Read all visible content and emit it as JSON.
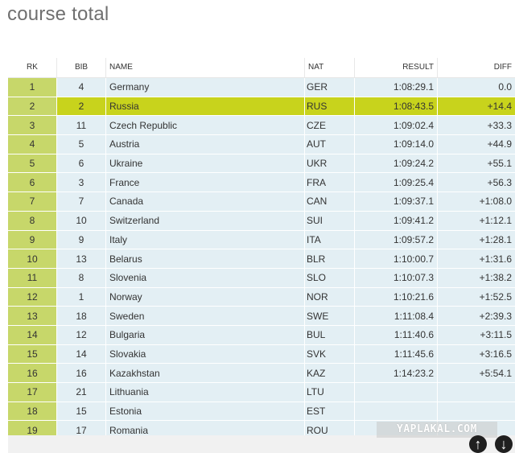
{
  "title": "course total",
  "columns": {
    "rk": "RK",
    "bib": "BIB",
    "name": "NAME",
    "nat": "NAT",
    "result": "RESULT",
    "diff": "DIFF"
  },
  "rows": [
    {
      "rk": "1",
      "bib": "4",
      "name": "Germany",
      "nat": "GER",
      "result": "1:08:29.1",
      "diff": "0.0"
    },
    {
      "rk": "2",
      "bib": "2",
      "name": "Russia",
      "nat": "RUS",
      "result": "1:08:43.5",
      "diff": "+14.4"
    },
    {
      "rk": "3",
      "bib": "11",
      "name": "Czech Republic",
      "nat": "CZE",
      "result": "1:09:02.4",
      "diff": "+33.3"
    },
    {
      "rk": "4",
      "bib": "5",
      "name": "Austria",
      "nat": "AUT",
      "result": "1:09:14.0",
      "diff": "+44.9"
    },
    {
      "rk": "5",
      "bib": "6",
      "name": "Ukraine",
      "nat": "UKR",
      "result": "1:09:24.2",
      "diff": "+55.1"
    },
    {
      "rk": "6",
      "bib": "3",
      "name": "France",
      "nat": "FRA",
      "result": "1:09:25.4",
      "diff": "+56.3"
    },
    {
      "rk": "7",
      "bib": "7",
      "name": "Canada",
      "nat": "CAN",
      "result": "1:09:37.1",
      "diff": "+1:08.0"
    },
    {
      "rk": "8",
      "bib": "10",
      "name": "Switzerland",
      "nat": "SUI",
      "result": "1:09:41.2",
      "diff": "+1:12.1"
    },
    {
      "rk": "9",
      "bib": "9",
      "name": "Italy",
      "nat": "ITA",
      "result": "1:09:57.2",
      "diff": "+1:28.1"
    },
    {
      "rk": "10",
      "bib": "13",
      "name": "Belarus",
      "nat": "BLR",
      "result": "1:10:00.7",
      "diff": "+1:31.6"
    },
    {
      "rk": "11",
      "bib": "8",
      "name": "Slovenia",
      "nat": "SLO",
      "result": "1:10:07.3",
      "diff": "+1:38.2"
    },
    {
      "rk": "12",
      "bib": "1",
      "name": "Norway",
      "nat": "NOR",
      "result": "1:10:21.6",
      "diff": "+1:52.5"
    },
    {
      "rk": "13",
      "bib": "18",
      "name": "Sweden",
      "nat": "SWE",
      "result": "1:11:08.4",
      "diff": "+2:39.3"
    },
    {
      "rk": "14",
      "bib": "12",
      "name": "Bulgaria",
      "nat": "BUL",
      "result": "1:11:40.6",
      "diff": "+3:11.5"
    },
    {
      "rk": "15",
      "bib": "14",
      "name": "Slovakia",
      "nat": "SVK",
      "result": "1:11:45.6",
      "diff": "+3:16.5"
    },
    {
      "rk": "16",
      "bib": "16",
      "name": "Kazakhstan",
      "nat": "KAZ",
      "result": "1:14:23.2",
      "diff": "+5:54.1"
    },
    {
      "rk": "17",
      "bib": "21",
      "name": "Lithuania",
      "nat": "LTU",
      "result": "",
      "diff": ""
    },
    {
      "rk": "18",
      "bib": "15",
      "name": "Estonia",
      "nat": "EST",
      "result": "",
      "diff": ""
    },
    {
      "rk": "19",
      "bib": "17",
      "name": "Romania",
      "nat": "ROU",
      "result": "",
      "diff": ""
    }
  ],
  "highlighted_row": 2,
  "watermark": "YAPLAKAL.COM",
  "controls": {
    "scroll_up_icon": "arrow-up-icon",
    "scroll_down_icon": "arrow-down-icon"
  },
  "colors": {
    "rank_cell": "#c7d76a",
    "row_bg": "#e3eff4",
    "highlight": "#c8d31c"
  }
}
